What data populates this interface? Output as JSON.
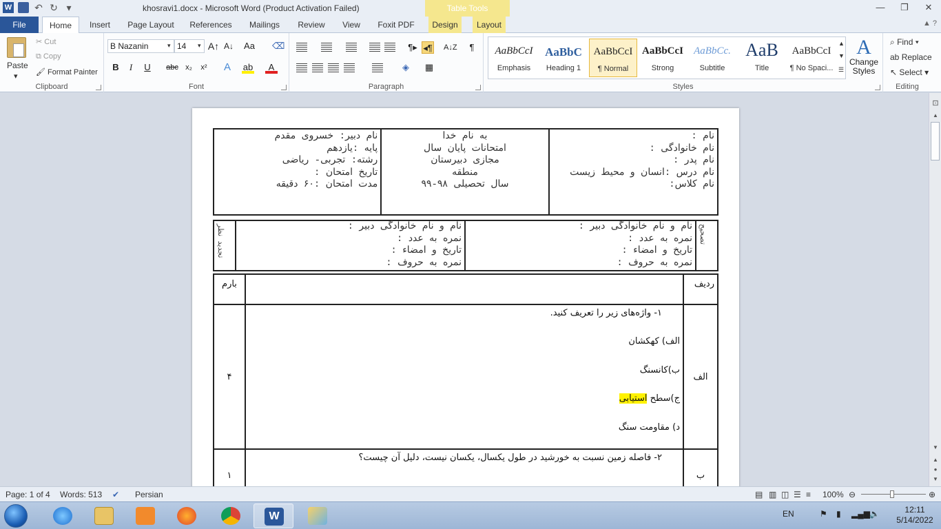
{
  "window": {
    "title": "khosravi1.docx - Microsoft Word (Product Activation Failed)",
    "contextual_tab_group": "Table Tools"
  },
  "tabs": [
    "File",
    "Home",
    "Insert",
    "Page Layout",
    "References",
    "Mailings",
    "Review",
    "View",
    "Foxit PDF",
    "Design",
    "Layout"
  ],
  "clipboard": {
    "paste": "Paste",
    "cut": "Cut",
    "copy": "Copy",
    "format_painter": "Format Painter",
    "group_label": "Clipboard"
  },
  "font": {
    "name": "B Nazanin",
    "size": "14",
    "group_label": "Font"
  },
  "paragraph": {
    "group_label": "Paragraph"
  },
  "styles": {
    "group_label": "Styles",
    "items": [
      {
        "sample": "AaBbCcI",
        "name": "Emphasis"
      },
      {
        "sample": "AaBbC",
        "name": "Heading 1"
      },
      {
        "sample": "AaBbCcI",
        "name": "¶ Normal"
      },
      {
        "sample": "AaBbCcI",
        "name": "Strong"
      },
      {
        "sample": "AaBbCc.",
        "name": "Subtitle"
      },
      {
        "sample": "AaB",
        "name": "Title"
      },
      {
        "sample": "AaBbCcI",
        "name": "¶ No Spaci..."
      }
    ],
    "change_styles": "Change Styles"
  },
  "editing": {
    "find": "Find",
    "replace": "Replace",
    "select": "Select",
    "group_label": "Editing"
  },
  "doc": {
    "header_left": [
      "نام دبیر: خسروی مقدم",
      "پایه :یازدهم",
      "رشته: تجربی- ریاضی",
      "تاریخ امتحان :",
      "مدت امتحان :۶۰ دقیقه"
    ],
    "header_center": [
      "به نام خدا",
      "امتحانات پایان سال",
      "مجازی دبیرستان",
      "منطقه",
      "سال تحصیلی ۹۸-۹۹"
    ],
    "header_right": [
      "نام :",
      "نام خانوادگی :",
      "نام پدر :",
      "نام درس :انسان و محیط زیست",
      "نام کلاس:"
    ],
    "grading_right": [
      "نام و نام خانوادگی دبیر :",
      "نمره به عدد :",
      "تاریخ و امضاء :",
      "نمره به حروف :"
    ],
    "grading_left": [
      "نام و نام خانوادگی دبیر :",
      "نمره به عدد :",
      "تاریخ و امضاء :",
      "نمره به حروف :"
    ],
    "grading_side_right": "تصحیح",
    "grading_side_left": "تجدید نظر",
    "col_row": "ردیف",
    "col_score": "بارم",
    "q1": {
      "row": "الف",
      "score": "۴",
      "title": "۱- واژه‌های زیر را تعریف کنید.",
      "a": "الف) کهکشان",
      "b": "ب)کانسنگ",
      "c_prefix": "ج)سطح",
      "c_highlight": "استیابی",
      "d": "د) مقاومت سنگ"
    },
    "q2": {
      "row": "ب",
      "score": "۱",
      "title": "۲- فاصله زمین نسبت به خورشید در طول یکسال، یکسان نیست، دلیل آن چیست؟"
    }
  },
  "status": {
    "page": "Page: 1 of 4",
    "words": "Words: 513",
    "language": "Persian",
    "zoom": "100%"
  },
  "taskbar": {
    "lang": "EN",
    "time": "12:11",
    "date": "5/14/2022"
  }
}
